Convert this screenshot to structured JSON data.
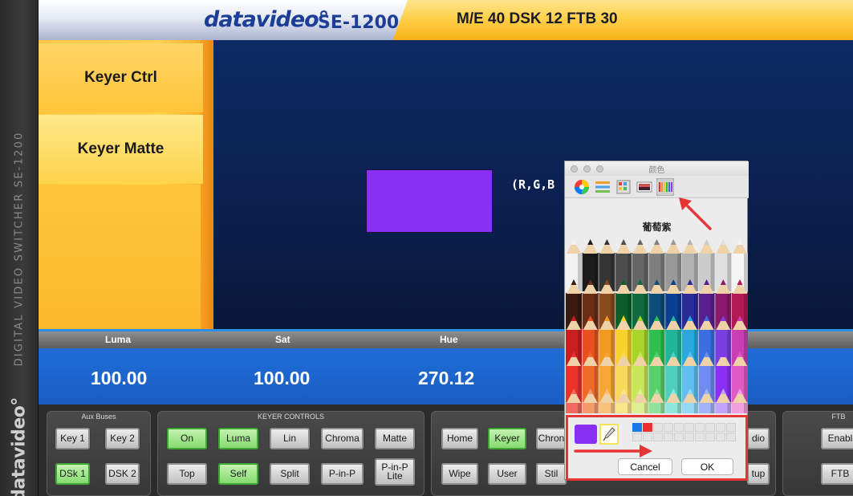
{
  "brand": {
    "vertical_text": "DIGITAL VIDEO SWITCHER   SE-1200",
    "vertical_logo": "datavideo°"
  },
  "header": {
    "logo_text": "datavideo°",
    "model": "SE-1200",
    "stats": "M/E 40  DSK 12  FTB 30"
  },
  "sidebar": {
    "items": [
      {
        "label": "Keyer Ctrl"
      },
      {
        "label": "Keyer Matte"
      }
    ]
  },
  "preview": {
    "swatch_color": "#8a30f5",
    "rgb_label": "(R,G,B"
  },
  "values": {
    "labels": [
      "Luma",
      "Sat",
      "Hue"
    ],
    "numbers": [
      "100.00",
      "100.00",
      "270.12"
    ]
  },
  "controls": {
    "aux_title": "Aux Buses",
    "aux_buttons": [
      "Key 1",
      "Key 2",
      "DSk 1",
      "DSK 2"
    ],
    "keyer_title": "KEYER CONTROLS",
    "keyer_buttons": [
      "On",
      "Luma",
      "Lin",
      "Chroma",
      "Matte",
      "Top",
      "Self",
      "Split",
      "P-in-P",
      "P-in-P Lite"
    ],
    "menu_buttons": [
      "Home",
      "Keyer",
      "Chron",
      "Wipe",
      "User",
      "Stil"
    ],
    "partial_buttons": [
      "dio",
      "tup"
    ],
    "ftb_title": "FTB",
    "ftb_buttons": [
      "Enabl",
      "FTB"
    ]
  },
  "picker": {
    "title": "颜色",
    "color_name": "葡萄紫",
    "current_color": "#8a30f5",
    "cancel_label": "Cancel",
    "ok_label": "OK",
    "pencil_colors": [
      [
        "#f2f2f2",
        "#1c1c1c",
        "#353535",
        "#4d4d4d",
        "#666",
        "#7f7f7f",
        "#999",
        "#b2b2b2",
        "#cccccc",
        "#e0e0e0",
        "#f5f5f5"
      ],
      [
        "#3a1c10",
        "#6b2d14",
        "#8a4a1e",
        "#0a5f2a",
        "#0f6b3f",
        "#0b4d7a",
        "#0b3f94",
        "#2a2a9a",
        "#5a1f8f",
        "#8a1a6b",
        "#b31953"
      ],
      [
        "#c91f1f",
        "#e8501f",
        "#f29a1d",
        "#f7d22a",
        "#a8d52a",
        "#2fbf4d",
        "#21b59c",
        "#2aa8de",
        "#3b6ee0",
        "#7a3fe0",
        "#c93fb3"
      ],
      [
        "#e8332a",
        "#f06a2a",
        "#f7a634",
        "#f9d95a",
        "#c7e65a",
        "#59d16b",
        "#4fcfc0",
        "#5fbff0",
        "#6f8cf0",
        "#8a30f5",
        "#e05ac5"
      ],
      [
        "#f06a5f",
        "#f59a6a",
        "#f9c27a",
        "#fbe68c",
        "#dff092",
        "#8fe39a",
        "#8ee6dc",
        "#95d8f7",
        "#a3b3f7",
        "#c3a3f7",
        "#f29fde"
      ]
    ],
    "swatch_grid": [
      [
        "#1a7ae8",
        "#e83030",
        "",
        "",
        "",
        "",
        "",
        "",
        "",
        ""
      ],
      [
        "",
        "",
        "",
        "",
        "",
        "",
        "",
        "",
        "",
        ""
      ]
    ]
  }
}
